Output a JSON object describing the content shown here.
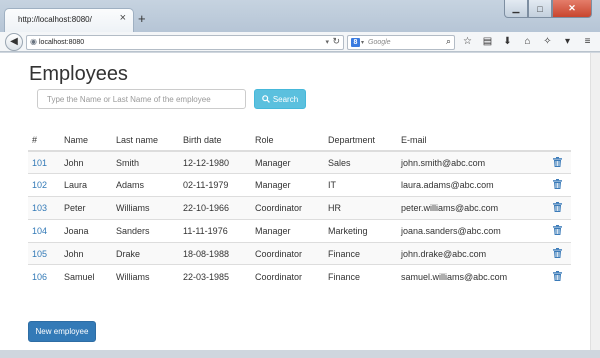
{
  "browser": {
    "tab_title": "http://localhost:8080/",
    "tab_close": "×",
    "new_tab": "+",
    "url": "localhost:8080",
    "search_engine_placeholder": "Google",
    "window_controls": {
      "minimize": "▁",
      "maximize": "□",
      "close": "✕"
    }
  },
  "page": {
    "title": "Employees",
    "search": {
      "placeholder": "Type the Name or Last Name of the employee",
      "value": "",
      "button_label": "Search",
      "button_icon": "search-icon"
    },
    "table": {
      "headers": [
        "#",
        "Name",
        "Last name",
        "Birth date",
        "Role",
        "Department",
        "E-mail"
      ],
      "rows": [
        {
          "id": "101",
          "name": "John",
          "last_name": "Smith",
          "birth_date": "12-12-1980",
          "role": "Manager",
          "department": "Sales",
          "email": "john.smith@abc.com"
        },
        {
          "id": "102",
          "name": "Laura",
          "last_name": "Adams",
          "birth_date": "02-11-1979",
          "role": "Manager",
          "department": "IT",
          "email": "laura.adams@abc.com"
        },
        {
          "id": "103",
          "name": "Peter",
          "last_name": "Williams",
          "birth_date": "22-10-1966",
          "role": "Coordinator",
          "department": "HR",
          "email": "peter.williams@abc.com"
        },
        {
          "id": "104",
          "name": "Joana",
          "last_name": "Sanders",
          "birth_date": "11-11-1976",
          "role": "Manager",
          "department": "Marketing",
          "email": "joana.sanders@abc.com"
        },
        {
          "id": "105",
          "name": "John",
          "last_name": "Drake",
          "birth_date": "18-08-1988",
          "role": "Coordinator",
          "department": "Finance",
          "email": "john.drake@abc.com"
        },
        {
          "id": "106",
          "name": "Samuel",
          "last_name": "Williams",
          "birth_date": "22-03-1985",
          "role": "Coordinator",
          "department": "Finance",
          "email": "samuel.williams@abc.com"
        }
      ],
      "row_action_icon": "trash-icon"
    },
    "new_button_label": "New employee"
  },
  "colors": {
    "link": "#337ab7",
    "search_button": "#5bc0de",
    "primary_button": "#337ab7"
  }
}
